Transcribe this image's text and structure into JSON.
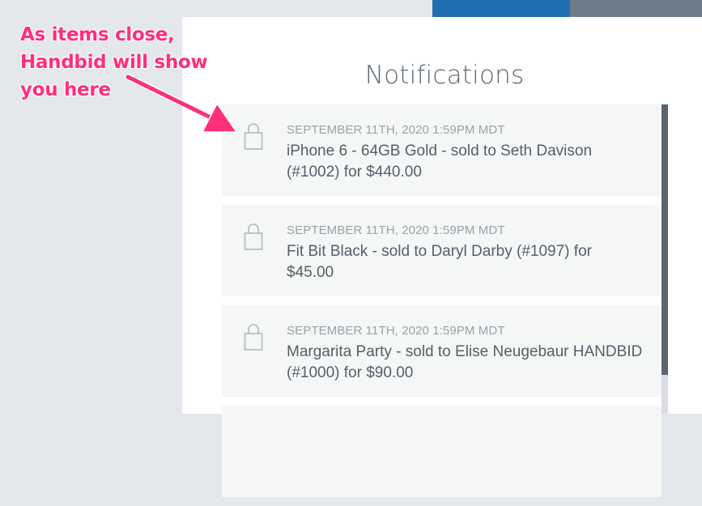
{
  "header": {
    "tab_active_color": "#1f6fb0",
    "tab_inactive_color": "#6d7b86"
  },
  "panel": {
    "title": "Notifications"
  },
  "notifications": [
    {
      "icon": "lock-icon",
      "timestamp": "SEPTEMBER 11TH, 2020 1:59PM MDT",
      "message": "iPhone 6 - 64GB Gold - sold to Seth Davison (#1002) for $440.00"
    },
    {
      "icon": "lock-icon",
      "timestamp": "SEPTEMBER 11TH, 2020 1:59PM MDT",
      "message": "Fit Bit Black - sold to Daryl Darby (#1097) for $45.00"
    },
    {
      "icon": "lock-icon",
      "timestamp": "SEPTEMBER 11TH, 2020 1:59PM MDT",
      "message": "Margarita Party - sold to Elise Neugebaur HANDBID (#1000) for $90.00"
    }
  ],
  "annotation": {
    "lines": [
      "As items close,",
      "Handbid will show",
      "you here"
    ],
    "color": "#ff2f7a"
  }
}
